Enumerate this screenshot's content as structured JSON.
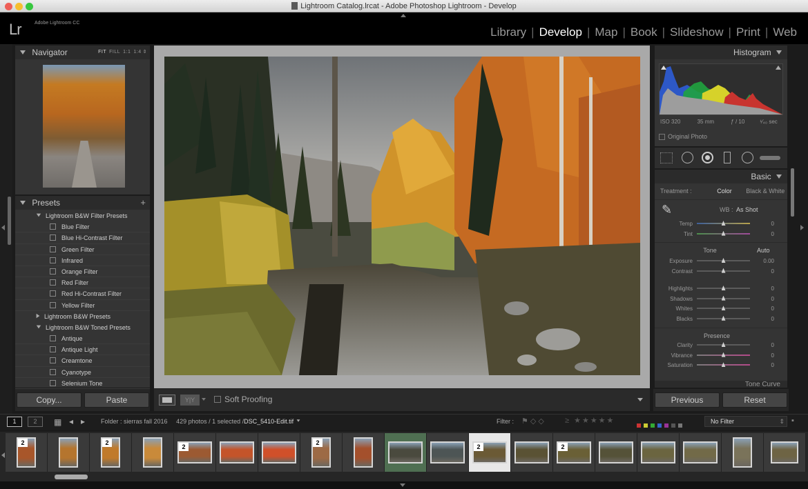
{
  "window": {
    "title": "Lightroom Catalog.lrcat - Adobe Photoshop Lightroom - Develop",
    "controls": {
      "close": "#ee5f57",
      "minimize": "#f6be2f",
      "zoom": "#37c73f"
    }
  },
  "brand": {
    "logo": "Lr",
    "product": "Adobe Lightroom CC"
  },
  "modules": [
    {
      "label": "Library",
      "active": false
    },
    {
      "label": "Develop",
      "active": true
    },
    {
      "label": "Map",
      "active": false
    },
    {
      "label": "Book",
      "active": false
    },
    {
      "label": "Slideshow",
      "active": false
    },
    {
      "label": "Print",
      "active": false
    },
    {
      "label": "Web",
      "active": false
    }
  ],
  "navigator": {
    "title": "Navigator",
    "zoom": [
      "FIT",
      "FILL",
      "1:1",
      "1:4"
    ]
  },
  "presets": {
    "title": "Presets",
    "add": "+",
    "tree": [
      {
        "type": "folder",
        "open": true,
        "label": "Lightroom B&W Filter Presets"
      },
      {
        "type": "item",
        "label": "Blue Filter"
      },
      {
        "type": "item",
        "label": "Blue Hi-Contrast Filter"
      },
      {
        "type": "item",
        "label": "Green Filter"
      },
      {
        "type": "item",
        "label": "Infrared"
      },
      {
        "type": "item",
        "label": "Orange Filter"
      },
      {
        "type": "item",
        "label": "Red Filter"
      },
      {
        "type": "item",
        "label": "Red Hi-Contrast Filter"
      },
      {
        "type": "item",
        "label": "Yellow Filter"
      },
      {
        "type": "folder",
        "open": false,
        "label": "Lightroom B&W Presets"
      },
      {
        "type": "folder",
        "open": true,
        "label": "Lightroom B&W Toned Presets"
      },
      {
        "type": "item",
        "label": "Antique"
      },
      {
        "type": "item",
        "label": "Antique Light"
      },
      {
        "type": "item",
        "label": "Creamtone"
      },
      {
        "type": "item",
        "label": "Cyanotype"
      },
      {
        "type": "item",
        "label": "Selenium Tone"
      }
    ]
  },
  "left_buttons": {
    "copy": "Copy...",
    "paste": "Paste"
  },
  "toolbar": {
    "soft_proofing": "Soft Proofing",
    "yy": "Y|Y"
  },
  "histogram": {
    "title": "Histogram",
    "iso": "ISO 320",
    "focal": "35 mm",
    "aperture": "ƒ / 10",
    "shutter": "¹⁄₄₀ sec",
    "original_photo": "Original Photo"
  },
  "basic": {
    "title": "Basic",
    "treatment_label": "Treatment :",
    "treatment_color": "Color",
    "treatment_bw": "Black & White",
    "wb_label": "WB :",
    "wb_value": "As Shot",
    "wb_sliders": [
      {
        "label": "Temp",
        "value": "0",
        "pos": 0.5
      },
      {
        "label": "Tint",
        "value": "0",
        "pos": 0.5
      }
    ],
    "tone_label": "Tone",
    "auto": "Auto",
    "tone_sliders": [
      {
        "label": "Exposure",
        "value": "0.00",
        "pos": 0.5
      },
      {
        "label": "Contrast",
        "value": "0",
        "pos": 0.5
      }
    ],
    "tone_sliders2": [
      {
        "label": "Highlights",
        "value": "0",
        "pos": 0.5
      },
      {
        "label": "Shadows",
        "value": "0",
        "pos": 0.5
      },
      {
        "label": "Whites",
        "value": "0",
        "pos": 0.5
      },
      {
        "label": "Blacks",
        "value": "0",
        "pos": 0.5
      }
    ],
    "presence_label": "Presence",
    "presence_sliders": [
      {
        "label": "Clarity",
        "value": "0",
        "pos": 0.5
      },
      {
        "label": "Vibrance",
        "value": "0",
        "pos": 0.5
      },
      {
        "label": "Saturation",
        "value": "0",
        "pos": 0.5
      }
    ],
    "next_panel": "Tone Curve"
  },
  "right_buttons": {
    "previous": "Previous",
    "reset": "Reset"
  },
  "filmstrip_bar": {
    "page1": "1",
    "page2": "2",
    "folder": "Folder : sierras fall 2016",
    "count": "429 photos / 1 selected /",
    "filename": "DSC_5410-Edit.tif",
    "filter_label": "Filter :",
    "no_filter": "No Filter"
  },
  "filmstrip": [
    {
      "w": 28,
      "h": 44,
      "badge": "2",
      "color": "#a8562a"
    },
    {
      "w": 28,
      "h": 44,
      "badge": "",
      "color": "#b5752e"
    },
    {
      "w": 28,
      "h": 44,
      "badge": "2",
      "color": "#c07a2b"
    },
    {
      "w": 28,
      "h": 44,
      "badge": "",
      "color": "#c98a3a"
    },
    {
      "w": 50,
      "h": 32,
      "badge": "2",
      "color": "#9c5a32"
    },
    {
      "w": 50,
      "h": 32,
      "badge": "",
      "color": "#c4542a"
    },
    {
      "w": 50,
      "h": 32,
      "badge": "",
      "color": "#d0502a"
    },
    {
      "w": 28,
      "h": 44,
      "badge": "2",
      "color": "#9d6a45"
    },
    {
      "w": 28,
      "h": 44,
      "badge": "",
      "color": "#a4502c"
    },
    {
      "w": 50,
      "h": 32,
      "badge": "",
      "color": "#4a4a3e",
      "tint": true
    },
    {
      "w": 50,
      "h": 32,
      "badge": "",
      "color": "#4d5555"
    },
    {
      "w": 50,
      "h": 32,
      "badge": "2",
      "color": "#6b5a35",
      "selected": true
    },
    {
      "w": 50,
      "h": 32,
      "badge": "",
      "color": "#5a5234"
    },
    {
      "w": 50,
      "h": 32,
      "badge": "2",
      "color": "#6a6036"
    },
    {
      "w": 50,
      "h": 32,
      "badge": "",
      "color": "#555238"
    },
    {
      "w": 50,
      "h": 32,
      "badge": "",
      "color": "#6b6540"
    },
    {
      "w": 50,
      "h": 32,
      "badge": "",
      "color": "#726a48"
    },
    {
      "w": 28,
      "h": 44,
      "badge": "",
      "color": "#7a735a"
    },
    {
      "w": 40,
      "h": 32,
      "badge": "",
      "color": "#6e6444"
    }
  ]
}
